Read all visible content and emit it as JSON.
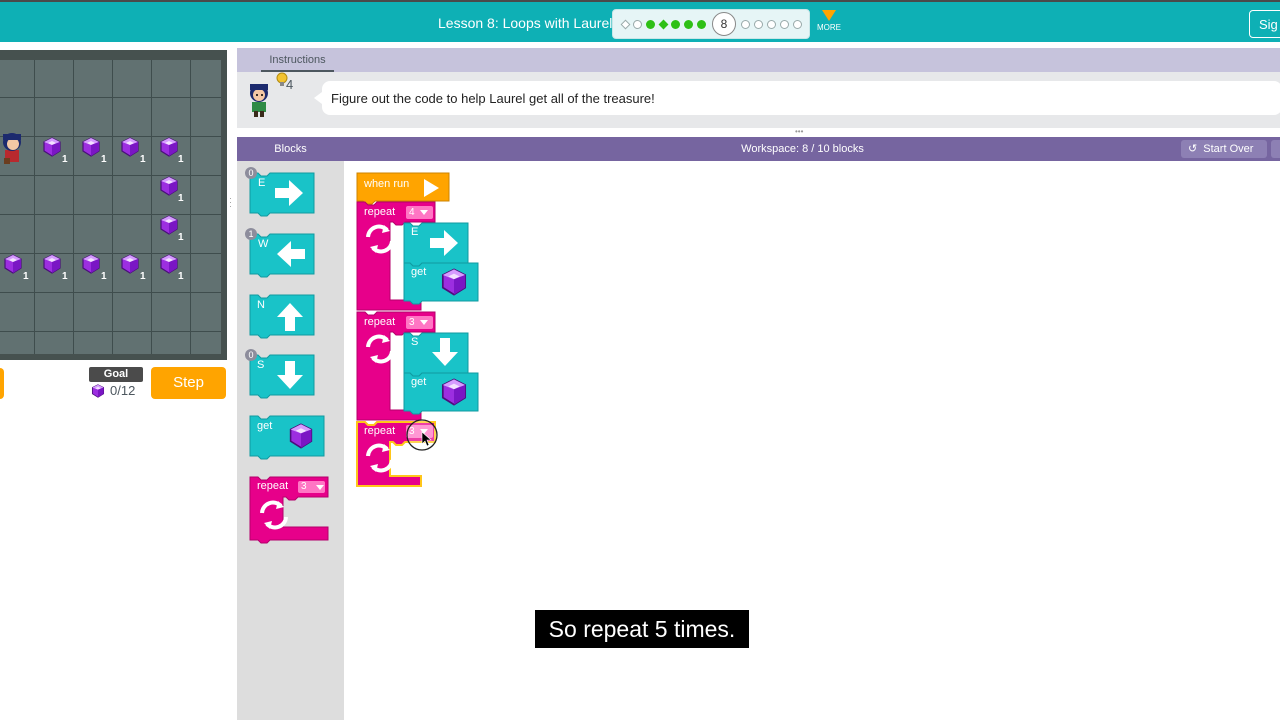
{
  "header": {
    "lesson_title": "Lesson 8: Loops with Laurel",
    "current_level": "8",
    "more_label": "MORE",
    "sign_in_label": "Sig"
  },
  "game": {
    "goal_label": "Goal",
    "goal_value": "0/12",
    "step_label": "Step",
    "gem_count": "1"
  },
  "instructions": {
    "tab_label": "Instructions",
    "hint_count": "4",
    "text": "Figure out the code to help Laurel get all of the treasure!"
  },
  "workspace_header": {
    "blocks_label": "Blocks",
    "workspace_count": "Workspace: 8 / 10 blocks",
    "start_over_label": "Start Over"
  },
  "toolbox": {
    "east_label": "E",
    "east_badge": "0",
    "west_label": "W",
    "west_badge": "1",
    "north_label": "N",
    "south_label": "S",
    "south_badge": "0",
    "get_label": "get",
    "repeat_label": "repeat",
    "repeat_count": "3"
  },
  "program": {
    "when_run_label": "when run",
    "repeat1_label": "repeat",
    "repeat1_count": "4",
    "move1_label": "E",
    "get1_label": "get",
    "repeat2_label": "repeat",
    "repeat2_count": "3",
    "move2_label": "S",
    "get2_label": "get",
    "repeat3_label": "repeat",
    "repeat3_count": "3"
  },
  "caption": "So repeat 5 times.",
  "colors": {
    "header": "#0eb0b5",
    "move_block": "#19c3c8",
    "loop_block": "#e7008a",
    "event_block": "#ffa400",
    "gem": "#9c2ee0",
    "workspace_bar": "#7665a0"
  }
}
